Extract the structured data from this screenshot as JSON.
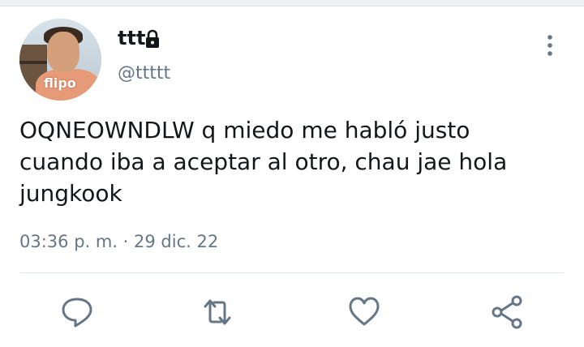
{
  "tweet": {
    "author": {
      "display_name": "ttt",
      "handle": "@ttttt",
      "avatar_caption": "flipo",
      "protected_icon": "lock-icon"
    },
    "text_lines": [
      "OQNEOWNDLW q miedo me habló justo",
      "cuando iba a aceptar al otro, chau jae hola",
      "jungkook"
    ],
    "timestamp": "03:36 p. m. · 29 dic. 22",
    "menu_icon": "more-vertical-icon",
    "actions": [
      {
        "icon": "reply-icon"
      },
      {
        "icon": "retweet-icon"
      },
      {
        "icon": "like-icon"
      },
      {
        "icon": "share-icon"
      }
    ]
  },
  "colors": {
    "text": "#14171a",
    "muted": "#657786",
    "icon": "#657786",
    "divider": "#e1e8ed"
  }
}
